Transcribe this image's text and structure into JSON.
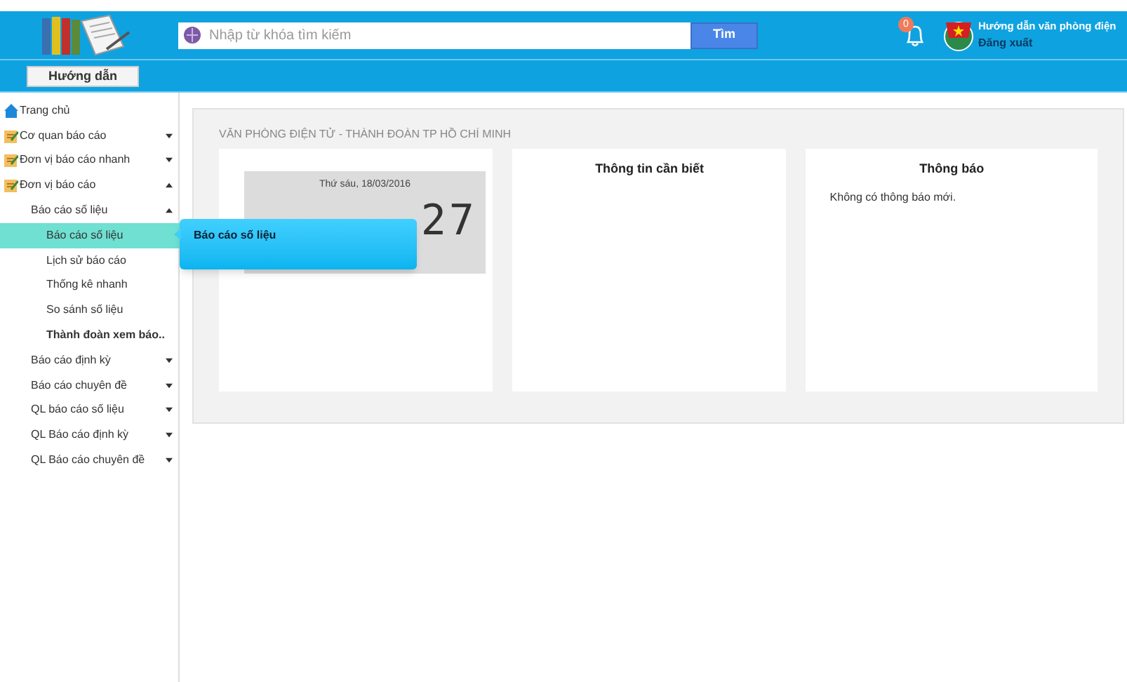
{
  "header": {
    "search": {
      "placeholder": "Nhập từ khóa tìm kiếm"
    },
    "search_button": "Tìm",
    "notifications": {
      "badge": "0"
    },
    "user": {
      "title": "Hướng dẫn văn phòng điện",
      "logout": "Đăng xuất"
    }
  },
  "toolbar": {
    "button": "Hướng dẫn"
  },
  "sidebar": {
    "items": [
      {
        "label": "Trang chủ",
        "kind": "home"
      },
      {
        "label": "Cơ quan báo cáo",
        "kind": "module",
        "expanded": false
      },
      {
        "label": "Đơn vị báo cáo nhanh",
        "kind": "module",
        "expanded": false
      },
      {
        "label": "Đơn vị báo cáo",
        "kind": "module",
        "expanded": true,
        "children": [
          {
            "label": "Báo cáo số liệu",
            "kind": "group",
            "expanded": true,
            "children": [
              {
                "label": "Báo cáo số liệu",
                "kind": "leaf",
                "selected": true,
                "emphasized": false
              },
              {
                "label": "Lịch sử báo cáo",
                "kind": "leaf",
                "selected": false,
                "emphasized": false
              },
              {
                "label": "Thống kê nhanh",
                "kind": "leaf",
                "selected": false,
                "emphasized": false
              },
              {
                "label": "So sánh số liệu",
                "kind": "leaf",
                "selected": false,
                "emphasized": false
              },
              {
                "label": "Thành đoàn xem báo..",
                "kind": "leaf",
                "selected": false,
                "emphasized": true
              }
            ]
          },
          {
            "label": "Báo cáo định kỳ",
            "kind": "group",
            "expanded": false
          },
          {
            "label": "Báo cáo chuyên đề",
            "kind": "group",
            "expanded": false
          },
          {
            "label": "QL báo cáo số liệu",
            "kind": "group",
            "expanded": false
          },
          {
            "label": "QL Báo cáo định kỳ",
            "kind": "group",
            "expanded": false
          },
          {
            "label": "QL Báo cáo chuyên đề",
            "kind": "group",
            "expanded": false
          }
        ]
      }
    ]
  },
  "tooltip": "Báo cáo số liệu",
  "main": {
    "title": "VĂN PHÒNG ĐIỆN TỬ - THÀNH ĐOÀN TP HỒ CHÍ MINH",
    "clock": {
      "date": "Thứ sáu, 18/03/2016",
      "time": "27"
    },
    "info_card": {
      "title": "Thông tin cần biết"
    },
    "notice_card": {
      "title": "Thông báo",
      "message": "Không có thông báo mới."
    }
  }
}
